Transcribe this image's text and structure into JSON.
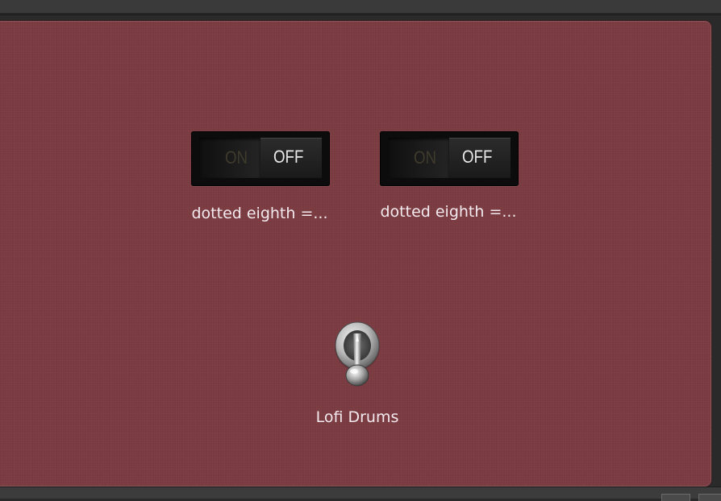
{
  "switches": [
    {
      "on_label": "ON",
      "off_label": "OFF",
      "caption": "dotted eighth =...",
      "state": "off"
    },
    {
      "on_label": "ON",
      "off_label": "OFF",
      "caption": "dotted eighth =...",
      "state": "off"
    }
  ],
  "toggle": {
    "caption": "Lofi Drums"
  },
  "colors": {
    "panel": "#7a3b40",
    "caption_text": "#f3eaf0",
    "off_text": "#e8e8e8",
    "on_text_dim": "#3e3a2c"
  },
  "icons": {
    "toggle": "toggle-switch-icon"
  }
}
